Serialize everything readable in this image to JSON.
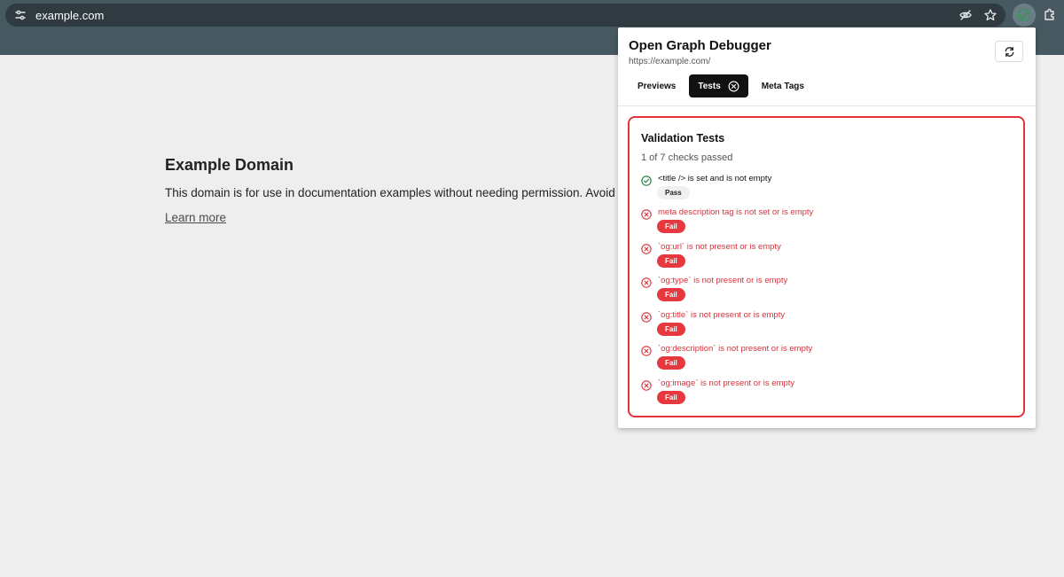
{
  "browser": {
    "url": "example.com"
  },
  "page": {
    "heading": "Example Domain",
    "paragraph": "This domain is for use in documentation examples without needing permission. Avoid use",
    "link": "Learn more"
  },
  "popup": {
    "title": "Open Graph Debugger",
    "url": "https://example.com/",
    "tabs": [
      {
        "label": "Previews",
        "active": false
      },
      {
        "label": "Tests",
        "active": true
      },
      {
        "label": "Meta Tags",
        "active": false
      }
    ],
    "card": {
      "title": "Validation Tests",
      "summary": "1 of 7 checks passed",
      "checks": [
        {
          "text": "<title /> is set and is not empty",
          "status": "pass",
          "badge": "Pass"
        },
        {
          "text": "meta description tag is not set or is empty",
          "status": "fail",
          "badge": "Fail"
        },
        {
          "text": "`og:url` is not present or is empty",
          "status": "fail",
          "badge": "Fail"
        },
        {
          "text": "`og:type` is not present or is empty",
          "status": "fail",
          "badge": "Fail"
        },
        {
          "text": "`og:title` is not present or is empty",
          "status": "fail",
          "badge": "Fail"
        },
        {
          "text": "`og:description` is not present or is empty",
          "status": "fail",
          "badge": "Fail"
        },
        {
          "text": "`og:image` is not present or is empty",
          "status": "fail",
          "badge": "Fail"
        }
      ]
    }
  },
  "colors": {
    "chrome": "#465860",
    "omnibox": "#2f3b41",
    "fail": "#e5383f",
    "pass": "#1f7a3a"
  },
  "icons": {
    "site_info": "tune-icon",
    "eye_off": "eye-off-icon",
    "star": "star-icon",
    "extension": "open-graph-extension-icon",
    "puzzle": "puzzle-icon",
    "refresh": "refresh-icon",
    "pass": "check-circle-icon",
    "fail": "x-circle-icon"
  }
}
